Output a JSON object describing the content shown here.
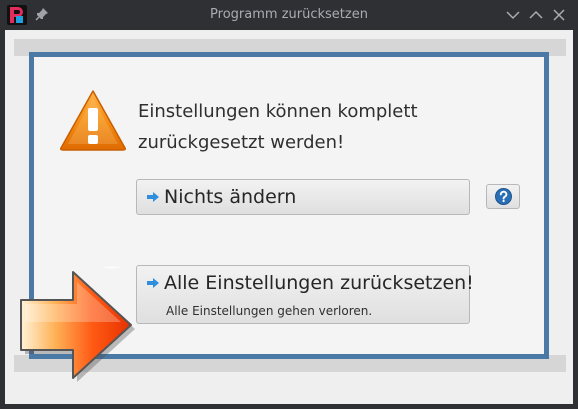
{
  "window": {
    "title": "Programm zurücksetzen"
  },
  "titlebar_icons": {
    "app": "app-logo-icon",
    "pin": "pin-icon",
    "minimize": "chevron-down-icon",
    "maximize": "chevron-up-icon",
    "close": "close-icon"
  },
  "dialog": {
    "message_line1": "Einstellungen können komplett",
    "message_line2": "zurückgesetzt werden!",
    "warning_icon": "warning-icon",
    "pointer_icon": "arrow-right-icon"
  },
  "buttons": {
    "nothing": {
      "label": "Nichts ändern",
      "icon": "arrow-right-icon"
    },
    "reset": {
      "label": "Alle Einstellungen zurücksetzen!",
      "sublabel": "Alle Einstellungen gehen verloren.",
      "icon": "arrow-right-icon"
    },
    "help": {
      "icon": "help-icon"
    }
  },
  "colors": {
    "panel_border": "#4b79a6",
    "warning_orange": "#f07c00",
    "button_arrow": "#2f8fdc",
    "help_blue": "#2a6fb5"
  }
}
